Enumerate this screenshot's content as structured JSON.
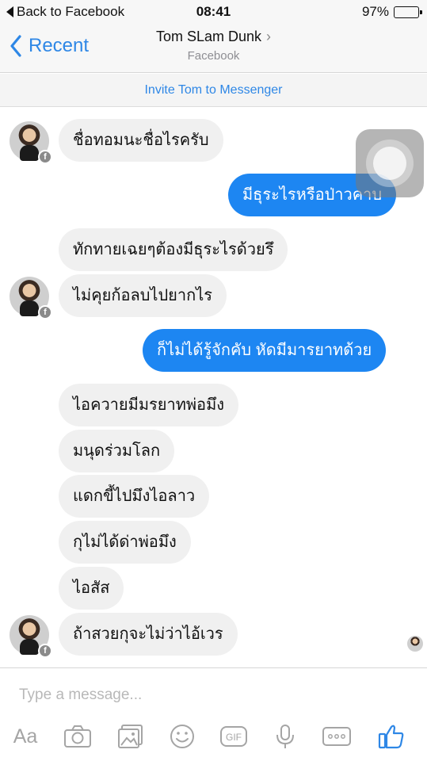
{
  "status_bar": {
    "back_label": "Back to Facebook",
    "time": "08:41",
    "battery": "97%",
    "battery_level": 0.97
  },
  "nav": {
    "back_label": "Recent",
    "title": "Tom SLam Dunk",
    "subtitle": "Facebook"
  },
  "invite_banner": "Invite Tom to Messenger",
  "messages": [
    {
      "from": "them",
      "text": "ชื่อทอมนะชื่อไรครับ"
    },
    {
      "from": "me",
      "text": "มีธุระไรหรือป่าวคาบ"
    },
    {
      "from": "them",
      "text": "ทักทายเฉยๆต้องมีธุระไรด้วยรึ"
    },
    {
      "from": "them",
      "text": "ไม่คุยก้อลบไปยากไร"
    },
    {
      "from": "me",
      "text": "ก็ไม่ได้รู้จักคับ หัดมีมารยาทด้วย"
    },
    {
      "from": "them",
      "text": "ไอควายมีมรยาทพ่อมึง"
    },
    {
      "from": "them",
      "text": "มนุดร่วมโลก"
    },
    {
      "from": "them",
      "text": "แดกขี้ไปมึงไอลาว"
    },
    {
      "from": "them",
      "text": "กุไม่ได้ด่าพ่อมึง"
    },
    {
      "from": "them",
      "text": "ไอสัส"
    },
    {
      "from": "them",
      "text": "ถ้าสวยกุจะไม่ว่าไอ้เวร"
    }
  ],
  "composer": {
    "placeholder": "Type a message...",
    "aa_label": "Aa",
    "gif_label": "GIF",
    "icons": [
      "camera-icon",
      "photo-icon",
      "emoji-icon",
      "gif-icon",
      "microphone-icon",
      "more-icon",
      "like-icon"
    ]
  },
  "colors": {
    "accent": "#2e87e6",
    "outgoing_bubble": "#1d86f2",
    "incoming_bubble": "#f0f0f0",
    "toolbar_icon": "#a5a5a5",
    "like_icon": "#2e87e6"
  }
}
